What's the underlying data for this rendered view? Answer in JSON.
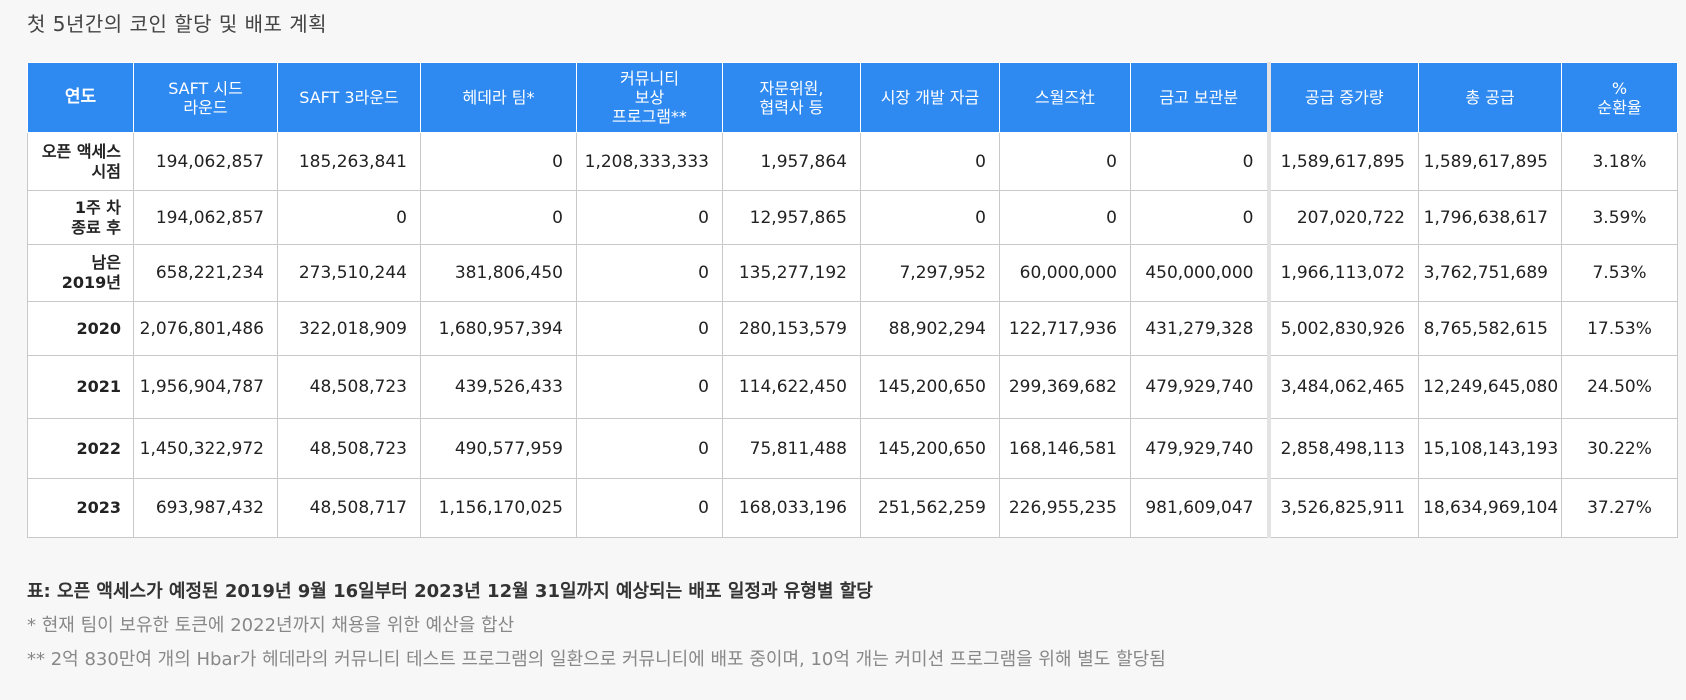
{
  "heading": "첫 5년간의 코인 할당 및 배포 계획",
  "table": {
    "headers": [
      "연도",
      "SAFT 시드\n라운드",
      "SAFT 3라운드",
      "헤데라 팀*",
      "커뮤니티\n보상\n프로그램**",
      "자문위원,\n협력사 등",
      "시장 개발 자금",
      "스월즈社",
      "금고 보관분",
      "공급 증가량",
      "총 공급",
      "%\n순환율"
    ],
    "rows": [
      {
        "year": "오픈 액세스\n시점",
        "cells": [
          "194,062,857",
          "185,263,841",
          "0",
          "1,208,333,333",
          "1,957,864",
          "0",
          "0",
          "0",
          "1,589,617,895",
          "1,589,617,895",
          "3.18%"
        ]
      },
      {
        "year": "1주 차\n종료 후",
        "cells": [
          "194,062,857",
          "0",
          "0",
          "0",
          "12,957,865",
          "0",
          "0",
          "0",
          "207,020,722",
          "1,796,638,617",
          "3.59%"
        ]
      },
      {
        "year": "남은\n2019년",
        "cells": [
          "658,221,234",
          "273,510,244",
          "381,806,450",
          "0",
          "135,277,192",
          "7,297,952",
          "60,000,000",
          "450,000,000",
          "1,966,113,072",
          "3,762,751,689",
          "7.53%"
        ]
      },
      {
        "year": "2020",
        "cells": [
          "2,076,801,486",
          "322,018,909",
          "1,680,957,394",
          "0",
          "280,153,579",
          "88,902,294",
          "122,717,936",
          "431,279,328",
          "5,002,830,926",
          "8,765,582,615",
          "17.53%"
        ]
      },
      {
        "year": "2021",
        "cells": [
          "1,956,904,787",
          "48,508,723",
          "439,526,433",
          "0",
          "114,622,450",
          "145,200,650",
          "299,369,682",
          "479,929,740",
          "3,484,062,465",
          "12,249,645,080",
          "24.50%"
        ]
      },
      {
        "year": "2022",
        "cells": [
          "1,450,322,972",
          "48,508,723",
          "490,577,959",
          "0",
          "75,811,488",
          "145,200,650",
          "168,146,581",
          "479,929,740",
          "2,858,498,113",
          "15,108,143,193",
          "30.22%"
        ]
      },
      {
        "year": "2023",
        "cells": [
          "693,987,432",
          "48,508,717",
          "1,156,170,025",
          "0",
          "168,033,196",
          "251,562,259",
          "226,955,235",
          "981,609,047",
          "3,526,825,911",
          "18,634,969,104",
          "37.27%"
        ]
      }
    ]
  },
  "caption": "표: 오픈 액세스가 예정된 2019년 9월 16일부터 2023년 12월 31일까지 예상되는 배포 일정과 유형별 할당",
  "notes": [
    "* 현재 팀이 보유한 토큰에 2022년까지 채용을 위한 예산을 합산",
    "** 2억 830만여 개의 Hbar가 헤데라의 커뮤니티 테스트 프로그램의 일환으로 커뮤니티에 배포 중이며, 10억 개는 커미션 프로그램을 위해 별도 할당됨"
  ]
}
